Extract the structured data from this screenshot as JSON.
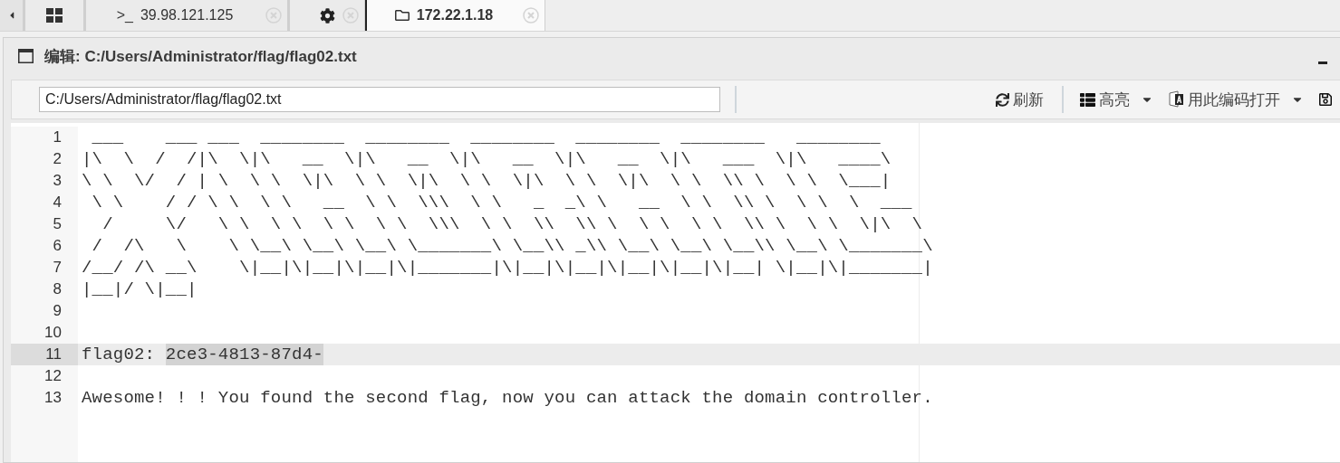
{
  "tabs": [
    {
      "kind": "grid",
      "selected": false,
      "closable": false
    },
    {
      "kind": "terminal",
      "prefix": ">_",
      "label": "39.98.121.125",
      "selected": false,
      "closable": true
    },
    {
      "kind": "settings",
      "selected": false,
      "closable": true
    },
    {
      "kind": "folder",
      "label": "172.22.1.18",
      "selected": true,
      "closable": true
    }
  ],
  "window": {
    "title": "编辑: C:/Users/Administrator/flag/flag02.txt"
  },
  "toolbar": {
    "path": "C:/Users/Administrator/flag/flag02.txt",
    "buttons": [
      {
        "kind": "refresh",
        "label": "刷新",
        "dropdown": false
      },
      {
        "kind": "highlight",
        "label": "高亮",
        "dropdown": true
      },
      {
        "kind": "encoding",
        "label": "用此编码打开",
        "dropdown": true
      },
      {
        "kind": "save",
        "dropdown": false
      }
    ]
  },
  "editor": {
    "lines": [
      {
        "number": "1",
        "current": false,
        "text": " ___    ___ ___  ________  ________  ________  ________  ________   ________"
      },
      {
        "number": "2",
        "current": false,
        "text": "|\\  \\  /  /|\\  \\|\\   __  \\|\\   __  \\|\\   __  \\|\\   __  \\|\\   ___  \\|\\   ____\\"
      },
      {
        "number": "3",
        "current": false,
        "text": "\\ \\  \\/  / | \\  \\ \\  \\|\\  \\ \\  \\|\\  \\ \\  \\|\\  \\ \\  \\|\\  \\ \\  \\\\ \\  \\ \\  \\___|"
      },
      {
        "number": "4",
        "current": false,
        "text": " \\ \\    / / \\ \\  \\ \\   __  \\ \\  \\\\\\  \\ \\   _  _\\ \\   __  \\ \\  \\\\ \\  \\ \\  \\  ___"
      },
      {
        "number": "5",
        "current": false,
        "text": "  /     \\/   \\ \\  \\ \\  \\ \\  \\ \\  \\\\\\  \\ \\  \\\\  \\\\ \\  \\ \\  \\ \\  \\\\ \\  \\ \\  \\|\\  \\"
      },
      {
        "number": "6",
        "current": false,
        "text": " /  /\\   \\    \\ \\__\\ \\__\\ \\__\\ \\_______\\ \\__\\\\ _\\\\ \\__\\ \\__\\ \\__\\\\ \\__\\ \\_______\\"
      },
      {
        "number": "7",
        "current": false,
        "text": "/__/ /\\ __\\    \\|__|\\|__|\\|__|\\|_______|\\|__|\\|__|\\|__|\\|__|\\|__| \\|__|\\|_______|"
      },
      {
        "number": "8",
        "current": false,
        "text": "|__|/ \\|__|"
      },
      {
        "number": "9",
        "current": false
      },
      {
        "number": "10",
        "current": false
      },
      {
        "number": "11",
        "current": true,
        "text": "flag02: ",
        "selected_text": "2ce3-4813-87d4-"
      },
      {
        "number": "12",
        "current": false
      },
      {
        "number": "13",
        "current": false,
        "text": "Awesome! ! ! You found the second flag, now you can attack the domain controller."
      }
    ]
  }
}
